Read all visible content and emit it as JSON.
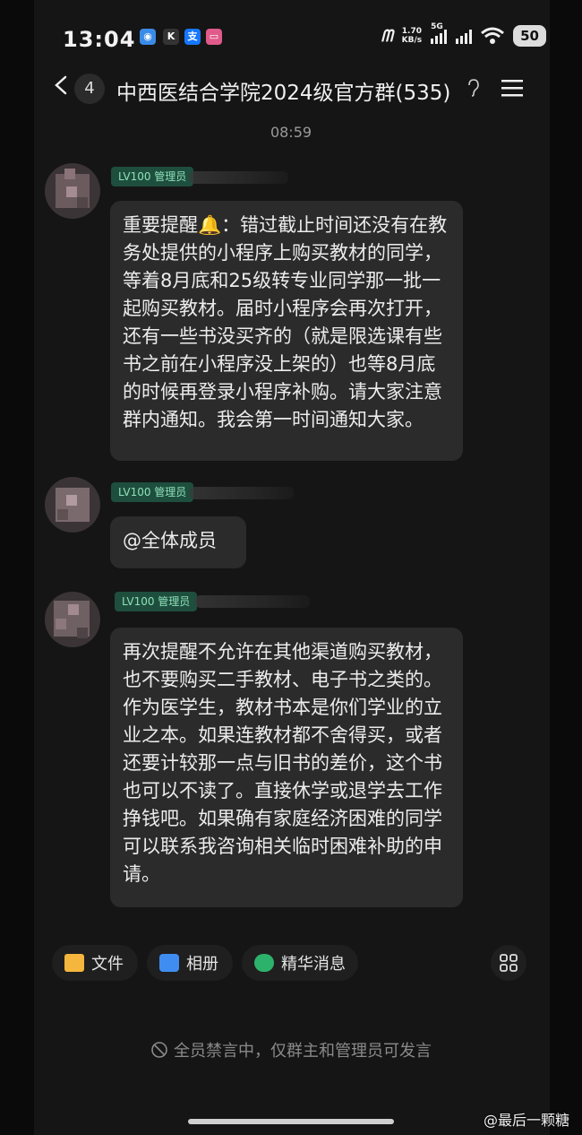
{
  "status_bar": {
    "time": "13:04",
    "network_speed": "1.70",
    "network_unit": "KB/s",
    "network_type": "5G",
    "battery": "50"
  },
  "header": {
    "unread_count": "4",
    "title": "中西医结合学院2024级官方群(535)"
  },
  "timestamp": "08:59",
  "messages": [
    {
      "role": "LV100 管理员",
      "text": "重要提醒🔔：错过截止时间还没有在教务处提供的小程序上购买教材的同学，等着8月底和25级转专业同学那一批一起购买教材。届时小程序会再次打开，还有一些书没买齐的（就是限选课有些书之前在小程序没上架的）也等8月底的时候再登录小程序补购。请大家注意群内通知。我会第一时间通知大家。"
    },
    {
      "role": "LV100 管理员",
      "text": "@全体成员"
    },
    {
      "role": "LV100 管理员",
      "text": "再次提醒不允许在其他渠道购买教材，也不要购买二手教材、电子书之类的。作为医学生，教材书本是你们学业的立业之本。如果连教材都不舍得买，或者还要计较那一点与旧书的差价，这个书也可以不读了。直接休学或退学去工作挣钱吧。如果确有家庭经济困难的同学可以联系我咨询相关临时困难补助的申请。"
    }
  ],
  "toolbar": {
    "files_label": "文件",
    "album_label": "相册",
    "highlights_label": "精华消息"
  },
  "mute_notice": "全员禁言中，仅群主和管理员可发言",
  "watermark": "@最后一颗糖",
  "colors": {
    "role_badge_bg": "#1e4e3d",
    "role_badge_text": "#8ee0b9",
    "bubble_bg": "#2b2b2b",
    "background": "#151515"
  }
}
